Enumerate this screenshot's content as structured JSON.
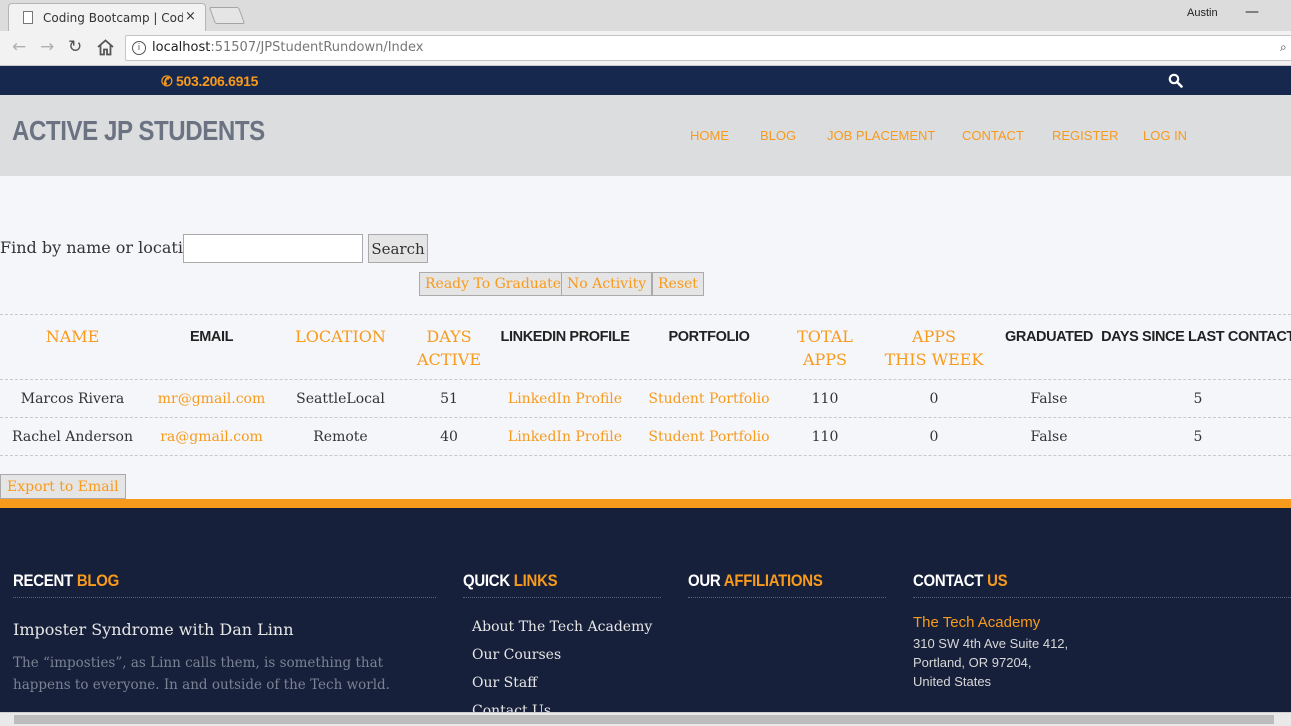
{
  "browser": {
    "tab_title": "Coding Bootcamp | Code",
    "tab_close": "×",
    "profile_name": "Austin",
    "url_host": "localhost",
    "url_path": ":51507/JPStudentRundown/Index"
  },
  "topbar": {
    "phone": "503.206.6915",
    "icons": [
      "phone-icon",
      "search-icon"
    ]
  },
  "header": {
    "title": "ACTIVE JP STUDENTS",
    "nav": [
      "HOME",
      "BLOG",
      "JOB PLACEMENT",
      "CONTACT",
      "REGISTER",
      "LOG IN"
    ]
  },
  "search": {
    "label": "Find by name or location:",
    "value": "",
    "button": "Search"
  },
  "filters": [
    "Ready To Graduate",
    "No Activity",
    "Reset"
  ],
  "table": {
    "headers": {
      "name": "NAME",
      "email": "EMAIL",
      "location": "LOCATION",
      "days_active_1": "DAYS",
      "days_active_2": "ACTIVE",
      "linkedin": "LINKEDIN PROFILE",
      "portfolio": "PORTFOLIO",
      "total_apps_1": "TOTAL",
      "total_apps_2": "APPS",
      "apps_week_1": "APPS",
      "apps_week_2": "THIS WEEK",
      "graduated": "GRADUATED",
      "days_since": "DAYS SINCE LAST CONTACT"
    },
    "rows": [
      {
        "name": "Marcos Rivera",
        "email": "mr@gmail.com",
        "location": "SeattleLocal",
        "days_active": "51",
        "linkedin": "LinkedIn Profile",
        "portfolio": "Student Portfolio",
        "total_apps": "110",
        "apps_week": "0",
        "graduated": "False",
        "days_since": "5"
      },
      {
        "name": "Rachel Anderson",
        "email": "ra@gmail.com",
        "location": "Remote",
        "days_active": "40",
        "linkedin": "LinkedIn Profile",
        "portfolio": "Student Portfolio",
        "total_apps": "110",
        "apps_week": "0",
        "graduated": "False",
        "days_since": "5"
      }
    ]
  },
  "export_button": "Export to Email",
  "footer": {
    "recent_blog": {
      "title_plain": "RECENT ",
      "title_accent": "BLOG"
    },
    "quick_links": {
      "title_plain": "QUICK ",
      "title_accent": "LINKS"
    },
    "affiliations": {
      "title_plain": "OUR ",
      "title_accent": "AFFILIATIONS"
    },
    "contact": {
      "title_plain": "CONTACT ",
      "title_accent": "US"
    },
    "blog_post_title": "Imposter Syndrome with Dan Linn",
    "blog_post_excerpt": "The “imposties”, as Linn calls them, is something that happens to everyone. In and outside of the Tech world.",
    "links": [
      "About The Tech Academy",
      "Our Courses",
      "Our Staff",
      "Contact Us"
    ],
    "org_name": "The Tech Academy",
    "address": [
      "310 SW 4th Ave Suite 412,",
      "Portland, OR 97204,",
      "United States"
    ]
  },
  "colors": {
    "accent": "#f89a1c",
    "navy": "#17284f",
    "footer_bg": "#17203a",
    "header_bg": "#dcdddf"
  }
}
